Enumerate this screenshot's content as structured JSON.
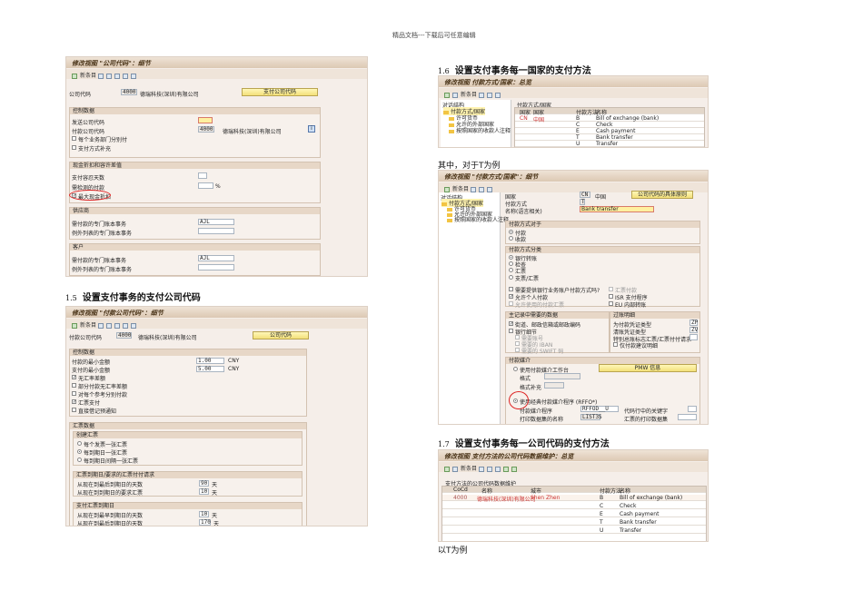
{
  "header_note": "精品文档---下载后可任意编辑",
  "toolbar_new_entries": "新条目",
  "s1": {
    "title": "修改视图 \"公司代码\"：细节",
    "cc_label": "公司代码",
    "cc": "4000",
    "cc_name": "德瑞科技(深圳)有限公司",
    "button": "支付公司代码",
    "g1": {
      "title": "控制数据",
      "send_cc": "发送公司代码",
      "pay_cc": "付款公司代码",
      "pay_cc_val": "4000",
      "pay_cc_name": "德瑞科技(深圳)有限公司",
      "cb1": "每个业务部门分别付",
      "cb2": "支付方式补充"
    },
    "g2": {
      "title": "现金折扣和容许差值",
      "grace": "支付容忍天数",
      "sought": "需检测的付款",
      "pct": "%",
      "maxdisc": "最大现金折扣"
    },
    "g3": {
      "title": "供应商",
      "sp": "需付款的专门账本事务",
      "sp_val": "AJL",
      "ex": "例外列表的专门账本事务"
    },
    "g4": {
      "title": "客户",
      "sp": "需付款的专门账本事务",
      "sp_val": "AJL",
      "ex": "例外列表的专门账本事务"
    }
  },
  "h15": {
    "num": "1.5",
    "text": "设置支付事务的支付公司代码"
  },
  "s2": {
    "title": "修改视图 \"付款公司代码\"：细节",
    "cc_label": "付款公司代码",
    "cc": "4000",
    "cc_name": "德瑞科技(深圳)有限公司",
    "button": "公司代码",
    "g1": {
      "title": "控制数据",
      "min_in": "付款的最小金额",
      "min_in_val": "1.00",
      "min_out": "支付的最小金额",
      "min_out_val": "5.00",
      "cur": "CNY",
      "cbs": [
        {
          "label": "无汇率差额",
          "on": true
        },
        {
          "label": "部分付款无汇率差额",
          "on": false
        },
        {
          "label": "对每个参考分别付款",
          "on": false
        },
        {
          "label": "汇票支付",
          "on": true
        },
        {
          "label": "直接借记预通知",
          "on": false
        }
      ]
    },
    "g2": {
      "title": "汇票数据",
      "sub1": "创建汇票",
      "radios": [
        "每个发票一张汇票",
        "每到期日一张汇票",
        "每到期日间隔一张汇票"
      ],
      "sub2": "汇票到期日/要求的汇票付付请求",
      "r1": "从现在到最后到期日的天数",
      "r1v": "90",
      "r2": "从现在到到期日的要求汇票",
      "r2v": "10",
      "sub3": "支付汇票到期日",
      "r3": "从现在到最早到期日的天数",
      "r3v": "10",
      "r4": "从现在到最后到期日的天数",
      "r4v": "170",
      "days": "天"
    }
  },
  "h16": {
    "num": "1.6",
    "text": "设置支付事务每一国家的支付方法"
  },
  "s3": {
    "title": "修改视图 付款方式/国家：总览",
    "tree_title": "对话结构",
    "tree": [
      "付款方式/国家",
      "许可货币",
      "允许的外部国家",
      "按照国家的收款人注释"
    ],
    "table_title": "付款方式/国家",
    "cols": [
      "国家",
      "国家",
      "付款方法",
      "名称"
    ],
    "rows": [
      {
        "c": "CN",
        "n": "中国",
        "m": "B",
        "d": "Bill of exchange (bank)"
      },
      {
        "m": "C",
        "d": "Check"
      },
      {
        "m": "E",
        "d": "Cash payment"
      },
      {
        "m": "T",
        "d": "Bank transfer"
      },
      {
        "m": "U",
        "d": "Transfer"
      }
    ]
  },
  "mid_text": "其中，对于T为例",
  "s4": {
    "title": "修改视图 \"付款方式/国家\"：细节",
    "tree_title": "对话结构",
    "tree": [
      "付款方式/国家",
      "许可货币",
      "允许的外部国家",
      "按照国家的收款人注释"
    ],
    "country": "国家",
    "country_val": "CN",
    "country_name": "中国",
    "button": "公司代码的具体原则",
    "pm": "付款方式",
    "pm_val": "T",
    "name": "名称(语言相关)",
    "name_val": "Bank transfer",
    "g1": {
      "title": "付款方式对于",
      "r": [
        "付款",
        "收款"
      ]
    },
    "g2": {
      "title": "付款方式分类",
      "r": [
        "银行转账",
        "检查",
        "汇票",
        "支票/汇票"
      ],
      "cb": [
        "需要提供银行业务账户付款方式吗?",
        "允许个人付款",
        "允许使用的付款汇票"
      ],
      "cb_r": [
        "汇票付款",
        "ISR 支付程序",
        "EU 内部转账"
      ]
    },
    "g3": {
      "title": "主记录中需要的数据",
      "cb": [
        "街道、邮政信箱或邮政编码",
        "银行细节"
      ],
      "sub": [
        "需要账号",
        "需要的 IBAN",
        "需要的 SWIFT 码"
      ]
    },
    "g4": {
      "title": "过账明细",
      "doc": "为付款凭证类型",
      "doc_val": "ZP",
      "clr": "清账凭证类型",
      "clr_val": "ZV",
      "sgl": "特别总账标志汇票/汇票付付请求",
      "cb": "仅付款建议明细"
    },
    "g5": {
      "title": "付款媒介",
      "pmw": "使用付款媒介工作台",
      "pmw_btn": "PMW 信息",
      "fmt": "格式",
      "fmt_sup": "格式补充",
      "classic": "使用经典付款媒介程序 (RFFO*)",
      "prog": "付款媒介程序",
      "prog_val": "RFFOD__U",
      "ds": "打印数据集的名称",
      "ds_val": "LIST3S",
      "key": "代码行中的关键字",
      "bill_ds": "汇票的打印数据集"
    }
  },
  "h17": {
    "num": "1.7",
    "text": "设置支付事务每一公司代码的支付方法"
  },
  "s5": {
    "title": "修改视图 支付方法的公司代码数据维护：总览",
    "group": "支付方法的公司代码数据维护",
    "cols": [
      "CoCd",
      "名称",
      "城市",
      "付款方法",
      "名称"
    ],
    "rows": [
      {
        "cc": "4000",
        "n": "德瑞科技(深圳)有限公司",
        "city": "Shen Zhen",
        "m": "B",
        "d": "Bill of exchange (bank)"
      },
      {
        "m": "C",
        "d": "Check"
      },
      {
        "m": "E",
        "d": "Cash payment"
      },
      {
        "m": "T",
        "d": "Bank transfer"
      },
      {
        "m": "U",
        "d": "Transfer"
      }
    ]
  },
  "end_text": "以T为例"
}
